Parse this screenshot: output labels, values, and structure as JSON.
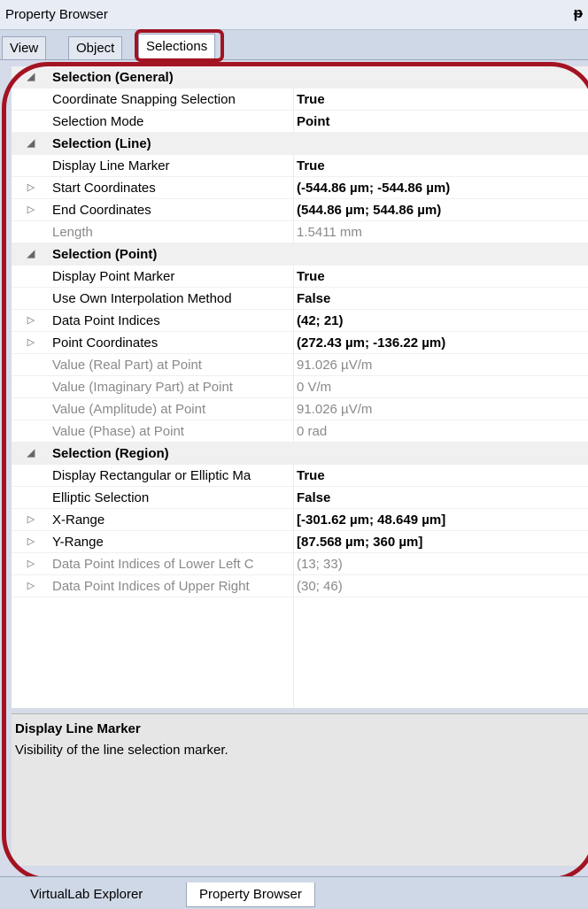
{
  "panel": {
    "title": "Property Browser",
    "pin_icon": "pin-icon"
  },
  "tabs": [
    {
      "label": "View"
    },
    {
      "label": "Object"
    },
    {
      "label": "Selections"
    }
  ],
  "categories": [
    {
      "title": "Selection (General)",
      "rows": [
        {
          "name": "Coordinate Snapping Selection",
          "value": "True",
          "expandable": false,
          "disabled": false
        },
        {
          "name": "Selection Mode",
          "value": "Point",
          "expandable": false,
          "disabled": false
        }
      ]
    },
    {
      "title": "Selection (Line)",
      "rows": [
        {
          "name": "Display Line Marker",
          "value": "True",
          "expandable": false,
          "disabled": false
        },
        {
          "name": "Start Coordinates",
          "value": "(-544.86 µm; -544.86 µm)",
          "expandable": true,
          "disabled": false
        },
        {
          "name": "End Coordinates",
          "value": "(544.86 µm; 544.86 µm)",
          "expandable": true,
          "disabled": false
        },
        {
          "name": "Length",
          "value": "1.5411 mm",
          "expandable": false,
          "disabled": true
        }
      ]
    },
    {
      "title": "Selection (Point)",
      "rows": [
        {
          "name": "Display Point Marker",
          "value": "True",
          "expandable": false,
          "disabled": false
        },
        {
          "name": "Use Own Interpolation Method",
          "value": "False",
          "expandable": false,
          "disabled": false
        },
        {
          "name": "Data Point Indices",
          "value": "(42; 21)",
          "expandable": true,
          "disabled": false
        },
        {
          "name": "Point Coordinates",
          "value": "(272.43 µm; -136.22 µm)",
          "expandable": true,
          "disabled": false
        },
        {
          "name": "Value (Real Part) at Point",
          "value": "91.026 µV/m",
          "expandable": false,
          "disabled": true
        },
        {
          "name": "Value (Imaginary Part) at Point",
          "value": "0 V/m",
          "expandable": false,
          "disabled": true
        },
        {
          "name": "Value (Amplitude) at Point",
          "value": "91.026 µV/m",
          "expandable": false,
          "disabled": true
        },
        {
          "name": "Value (Phase) at Point",
          "value": "0 rad",
          "expandable": false,
          "disabled": true
        }
      ]
    },
    {
      "title": "Selection (Region)",
      "rows": [
        {
          "name": "Display Rectangular or Elliptic Ma",
          "value": "True",
          "expandable": false,
          "disabled": false
        },
        {
          "name": "Elliptic Selection",
          "value": "False",
          "expandable": false,
          "disabled": false
        },
        {
          "name": "X-Range",
          "value": "[-301.62 µm; 48.649 µm]",
          "expandable": true,
          "disabled": false
        },
        {
          "name": "Y-Range",
          "value": "[87.568 µm; 360 µm]",
          "expandable": true,
          "disabled": false
        },
        {
          "name": "Data Point Indices of Lower Left C",
          "value": "(13; 33)",
          "expandable": true,
          "disabled": true
        },
        {
          "name": "Data Point Indices of Upper Right",
          "value": "(30; 46)",
          "expandable": true,
          "disabled": true
        }
      ]
    }
  ],
  "description": {
    "title": "Display Line Marker",
    "text": "Visibility of the line selection marker."
  },
  "bottom_tabs": [
    {
      "label": "VirtualLab Explorer"
    },
    {
      "label": "Property Browser"
    }
  ],
  "colors": {
    "highlight": "#a31322",
    "chrome": "#cfd8e6"
  }
}
